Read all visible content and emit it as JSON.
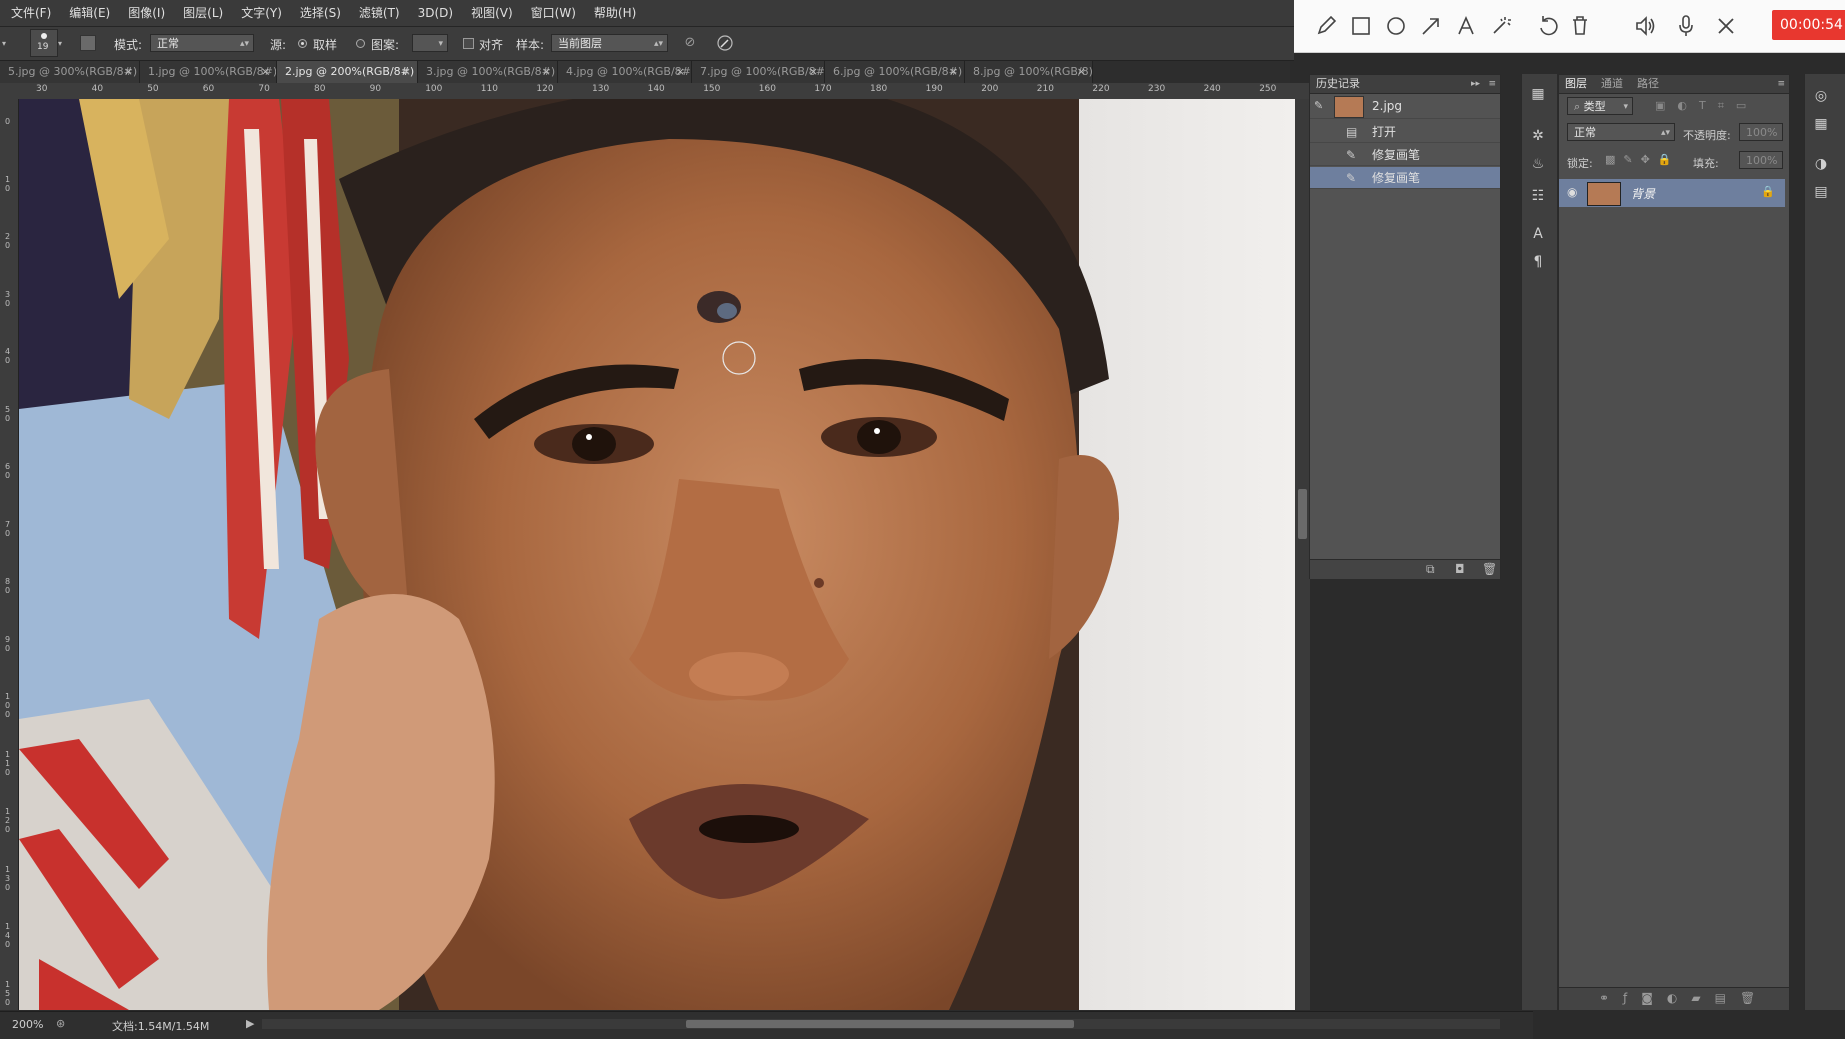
{
  "menu": [
    "文件(F)",
    "编辑(E)",
    "图像(I)",
    "图层(L)",
    "文字(Y)",
    "选择(S)",
    "滤镜(T)",
    "3D(D)",
    "视图(V)",
    "窗口(W)",
    "帮助(H)"
  ],
  "annotation_toolbar": {
    "tools": [
      "pencil-icon",
      "rectangle-icon",
      "circle-icon",
      "arrow-icon",
      "text-icon",
      "magic-wand-icon",
      "undo-icon",
      "trash-icon",
      "speaker-icon",
      "microphone-icon",
      "close-icon"
    ],
    "timer": "00:00:54"
  },
  "options": {
    "brush_size": "19",
    "mode_label": "模式:",
    "mode_value": "正常",
    "source_label": "源:",
    "sampled_label": "取样",
    "pattern_label": "图案:",
    "aligned_label": "对齐",
    "sample_label": "样本:",
    "sample_value": "当前图层"
  },
  "tabs": [
    {
      "label": "5.jpg @ 300%(RGB/8#) *",
      "active": false
    },
    {
      "label": "1.jpg @ 100%(RGB/8#)",
      "active": false
    },
    {
      "label": "2.jpg @ 200%(RGB/8#) *",
      "active": true
    },
    {
      "label": "3.jpg @ 100%(RGB/8#) *",
      "active": false
    },
    {
      "label": "4.jpg @ 100%(RGB/8#)",
      "active": false
    },
    {
      "label": "7.jpg @ 100%(RGB/8#)",
      "active": false
    },
    {
      "label": "6.jpg @ 100%(RGB/8#) *",
      "active": false
    },
    {
      "label": "8.jpg @ 100%(RGB/8)",
      "active": false
    }
  ],
  "ruler_h": [
    "30",
    "40",
    "50",
    "60",
    "70",
    "80",
    "90",
    "100",
    "110",
    "120",
    "130",
    "140",
    "150",
    "160",
    "170",
    "180",
    "190",
    "200",
    "210",
    "220",
    "230",
    "240",
    "250"
  ],
  "ruler_v": [
    "0",
    "1\n0",
    "2\n0",
    "3\n0",
    "4\n0",
    "5\n0",
    "6\n0",
    "7\n0",
    "8\n0",
    "9\n0",
    "1\n0\n0",
    "1\n1\n0",
    "1\n2\n0",
    "1\n3\n0",
    "1\n4\n0",
    "1\n5\n0"
  ],
  "history": {
    "title": "历史记录",
    "snapshot": "2.jpg",
    "items": [
      "打开",
      "修复画笔",
      "修复画笔"
    ],
    "selected_index": 2
  },
  "layers": {
    "tabs": [
      "图层",
      "通道",
      "路径"
    ],
    "kind_filter": "类型",
    "blend_mode": "正常",
    "opacity_label": "不透明度:",
    "opacity_value": "100%",
    "lock_label": "锁定:",
    "fill_label": "填充:",
    "fill_value": "100%",
    "layer_name": "背景"
  },
  "status": {
    "zoom": "200%",
    "doc_info": "文档:1.54M/1.54M"
  }
}
